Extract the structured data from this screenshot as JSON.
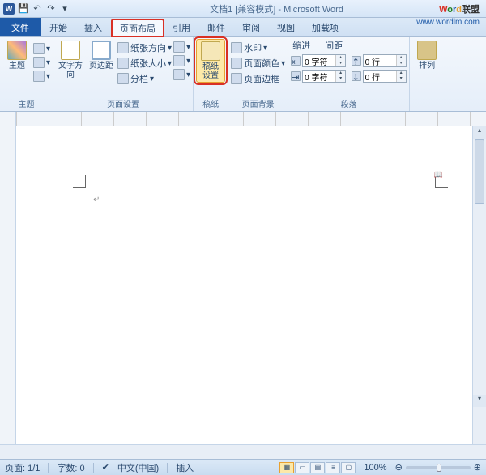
{
  "titlebar": {
    "app_icon": "W",
    "title": "文档1 [兼容模式] - Microsoft Word"
  },
  "tabs": {
    "file": "文件",
    "home": "开始",
    "insert": "插入",
    "layout": "页面布局",
    "ref": "引用",
    "mail": "邮件",
    "review": "审阅",
    "view": "视图",
    "addin": "加载项"
  },
  "ribbon": {
    "theme": {
      "btn": "主题",
      "group": "主题"
    },
    "pagesetup": {
      "textdir": "文字方向",
      "margins": "页边距",
      "orient": "纸张方向",
      "size": "纸张大小",
      "columns": "分栏",
      "group": "页面设置"
    },
    "manuscript": {
      "btn": "稿纸\n设置",
      "group": "稿纸"
    },
    "pagebg": {
      "watermark": "水印",
      "color": "页面颜色",
      "border": "页面边框",
      "group": "页面背景"
    },
    "paragraph": {
      "indent": "缩进",
      "spacing": "间距",
      "left": "0 字符",
      "right": "0 字符",
      "before": "0 行",
      "after": "0 行",
      "group": "段落"
    },
    "arrange": {
      "btn": "排列",
      "group": ""
    }
  },
  "status": {
    "page": "页面: 1/1",
    "words": "字数: 0",
    "lang": "中文(中国)",
    "mode": "插入",
    "zoom": "100%",
    "zoombtn": "⊕"
  },
  "watermark": {
    "url": "www.wordlm.com",
    "cn": "联盟"
  }
}
